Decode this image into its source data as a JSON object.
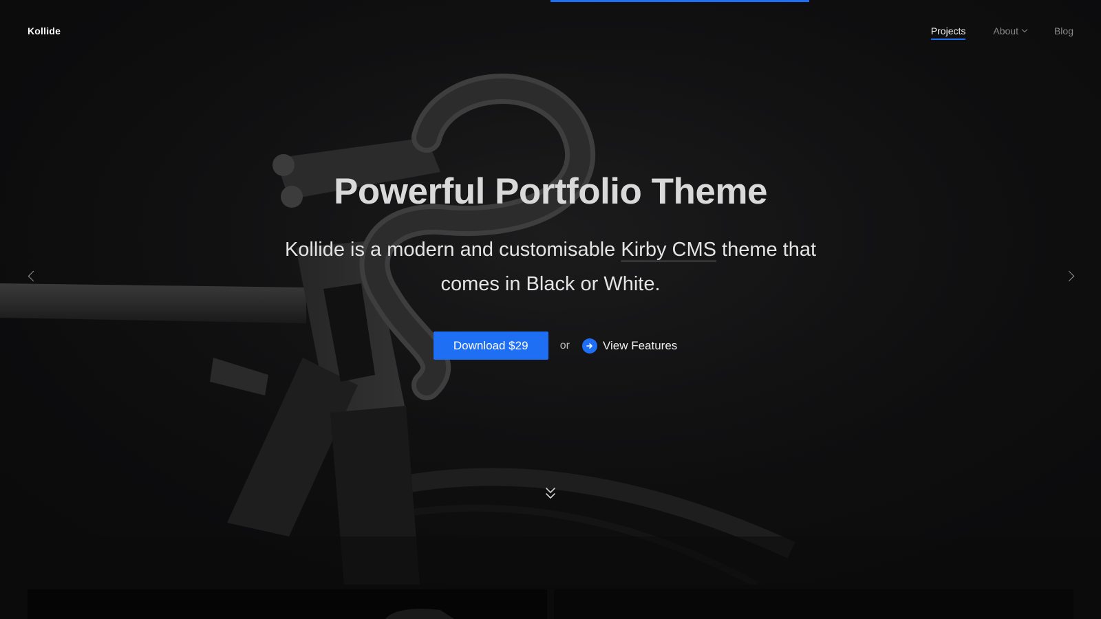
{
  "header": {
    "logo": "Kollide",
    "nav": [
      {
        "label": "Projects",
        "active": true
      },
      {
        "label": "About",
        "has_dropdown": true
      },
      {
        "label": "Blog"
      }
    ]
  },
  "hero": {
    "headline": "Powerful Portfolio Theme",
    "subtext_before": "Kollide is a modern and customisable ",
    "subtext_link": "Kirby CMS",
    "subtext_after": " theme that comes in Black or White.",
    "download_label": "Download $29",
    "or_label": "or",
    "features_label": "View Features"
  },
  "icons": {
    "prev": "chevron-left-icon",
    "next": "chevron-right-icon",
    "scroll": "double-chevron-down-icon",
    "features": "arrow-right-icon"
  },
  "colors": {
    "accent": "#1f6ff5",
    "background": "#0b0b0c"
  }
}
